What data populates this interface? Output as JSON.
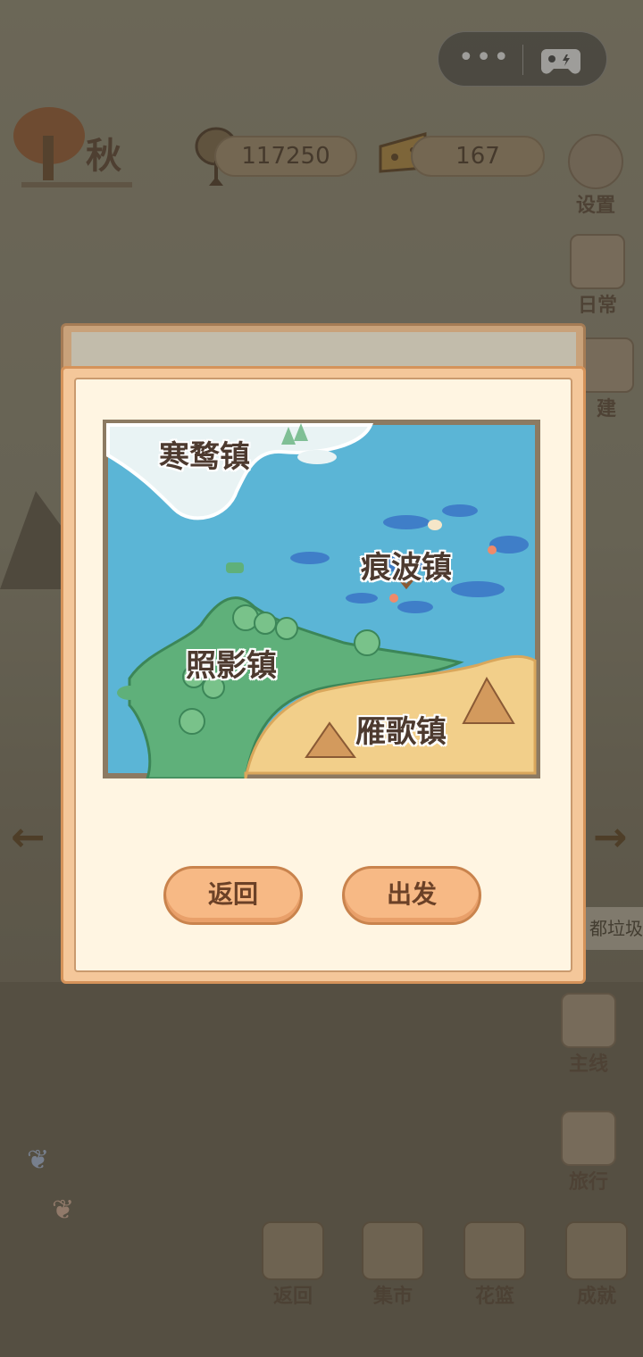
{
  "header": {
    "season": "秋",
    "fish_currency": "117250",
    "cheese_currency": "167"
  },
  "side_menu": [
    {
      "label": "设置",
      "icon": "gear-icon"
    },
    {
      "label": "日常",
      "icon": "daily-note-icon"
    },
    {
      "label": "建",
      "icon": "build-hammer-icon"
    },
    {
      "label": "主线",
      "icon": "main-quest-icon"
    },
    {
      "label": "旅行",
      "icon": "travel-mountain-icon"
    }
  ],
  "bottom_menu": [
    {
      "label": "返回",
      "icon": "door-icon"
    },
    {
      "label": "集市",
      "icon": "market-stall-icon"
    },
    {
      "label": "花篮",
      "icon": "flower-basket-icon"
    },
    {
      "label": "成就",
      "icon": "trophy-icon"
    }
  ],
  "trash_tag": "都垃圾",
  "map": {
    "towns": [
      "寒鹜镇",
      "痕波镇",
      "照影镇",
      "雁歌镇"
    ]
  },
  "dialog": {
    "back_label": "返回",
    "depart_label": "出发"
  },
  "colors": {
    "dialog_frame": "#f4c79a",
    "dialog_inner": "#fff5e2",
    "button_fill": "#f7b985",
    "button_text": "#6b4127",
    "sea": "#5bb5d6",
    "grass": "#5fb07a",
    "sand": "#f2cf8a",
    "snow": "#e9f3f4"
  }
}
